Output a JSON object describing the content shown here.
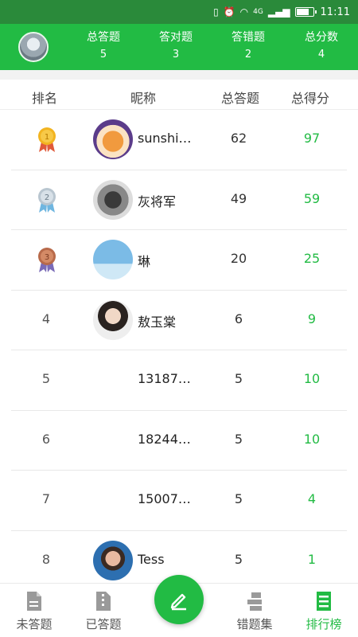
{
  "status_bar": {
    "time": "11:11",
    "network": "4G"
  },
  "header": {
    "stats": [
      {
        "label": "总答题",
        "value": "5"
      },
      {
        "label": "答对题",
        "value": "3"
      },
      {
        "label": "答错题",
        "value": "2"
      },
      {
        "label": "总分数",
        "value": "4"
      }
    ]
  },
  "columns": {
    "rank": "排名",
    "nickname": "昵称",
    "total_questions": "总答题",
    "total_score": "总得分"
  },
  "rows": [
    {
      "rank": "1",
      "medal": "gold",
      "nickname": "sunshi…",
      "total": "62",
      "score": "97",
      "avatar": "fox-avatar"
    },
    {
      "rank": "2",
      "medal": "silver",
      "nickname": "灰将军",
      "total": "49",
      "score": "59",
      "avatar": "horse-rider-avatar"
    },
    {
      "rank": "3",
      "medal": "bronze",
      "nickname": "琳",
      "total": "20",
      "score": "25",
      "avatar": "sky-avatar"
    },
    {
      "rank": "4",
      "medal": "",
      "nickname": "敖玉棠",
      "total": "6",
      "score": "9",
      "avatar": "girl-avatar"
    },
    {
      "rank": "5",
      "medal": "",
      "nickname": "13187…",
      "total": "5",
      "score": "10",
      "avatar": ""
    },
    {
      "rank": "6",
      "medal": "",
      "nickname": "18244…",
      "total": "5",
      "score": "10",
      "avatar": ""
    },
    {
      "rank": "7",
      "medal": "",
      "nickname": "15007…",
      "total": "5",
      "score": "4",
      "avatar": ""
    },
    {
      "rank": "8",
      "medal": "",
      "nickname": "Tess",
      "total": "5",
      "score": "1",
      "avatar": "tess-avatar"
    }
  ],
  "tabs": [
    {
      "label": "未答题",
      "icon": "document-icon",
      "active": false
    },
    {
      "label": "已答题",
      "icon": "zip-document-icon",
      "active": false
    },
    {
      "label": "错题集",
      "icon": "wrong-set-icon",
      "active": false
    },
    {
      "label": "排行榜",
      "icon": "leaderboard-icon",
      "active": true
    }
  ],
  "fab": {
    "icon": "pencil-icon"
  },
  "colors": {
    "brand_green": "#22bb44",
    "status_green": "#2a8a3a"
  }
}
